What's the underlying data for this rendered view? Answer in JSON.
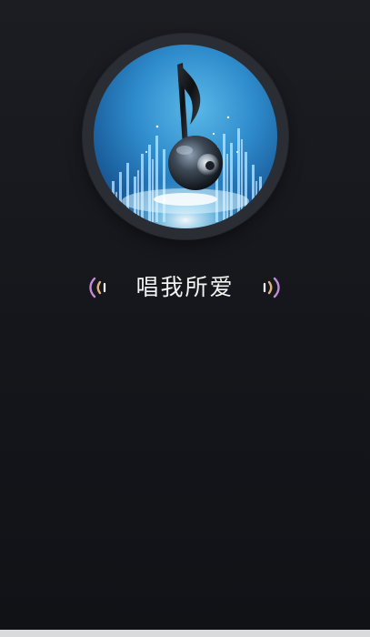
{
  "header": {
    "title": "唱我所爱"
  },
  "artwork": {
    "icon": "music-note-speaker-icon"
  },
  "colors": {
    "background_top": "#1b1d22",
    "background_bottom": "#101216",
    "artwork_ring": "#2a2d33",
    "artwork_blue": "#2f8ccc",
    "wave_pink": "#c08bd6",
    "wave_gold": "#e0b080",
    "title_text": "#f2f2f2"
  }
}
